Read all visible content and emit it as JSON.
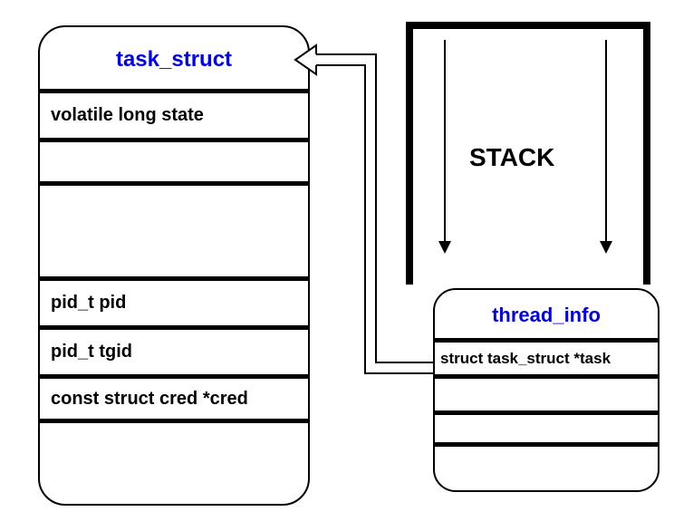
{
  "taskStruct": {
    "title": "task_struct",
    "rows": [
      "volatile long    state",
      "",
      "",
      "pid_t    pid",
      "pid_t    tgid",
      "const struct cred *cred"
    ]
  },
  "stack": {
    "label": "STACK"
  },
  "threadInfo": {
    "title": "thread_info",
    "rows": [
      "struct task_struct *task",
      "",
      ""
    ]
  }
}
